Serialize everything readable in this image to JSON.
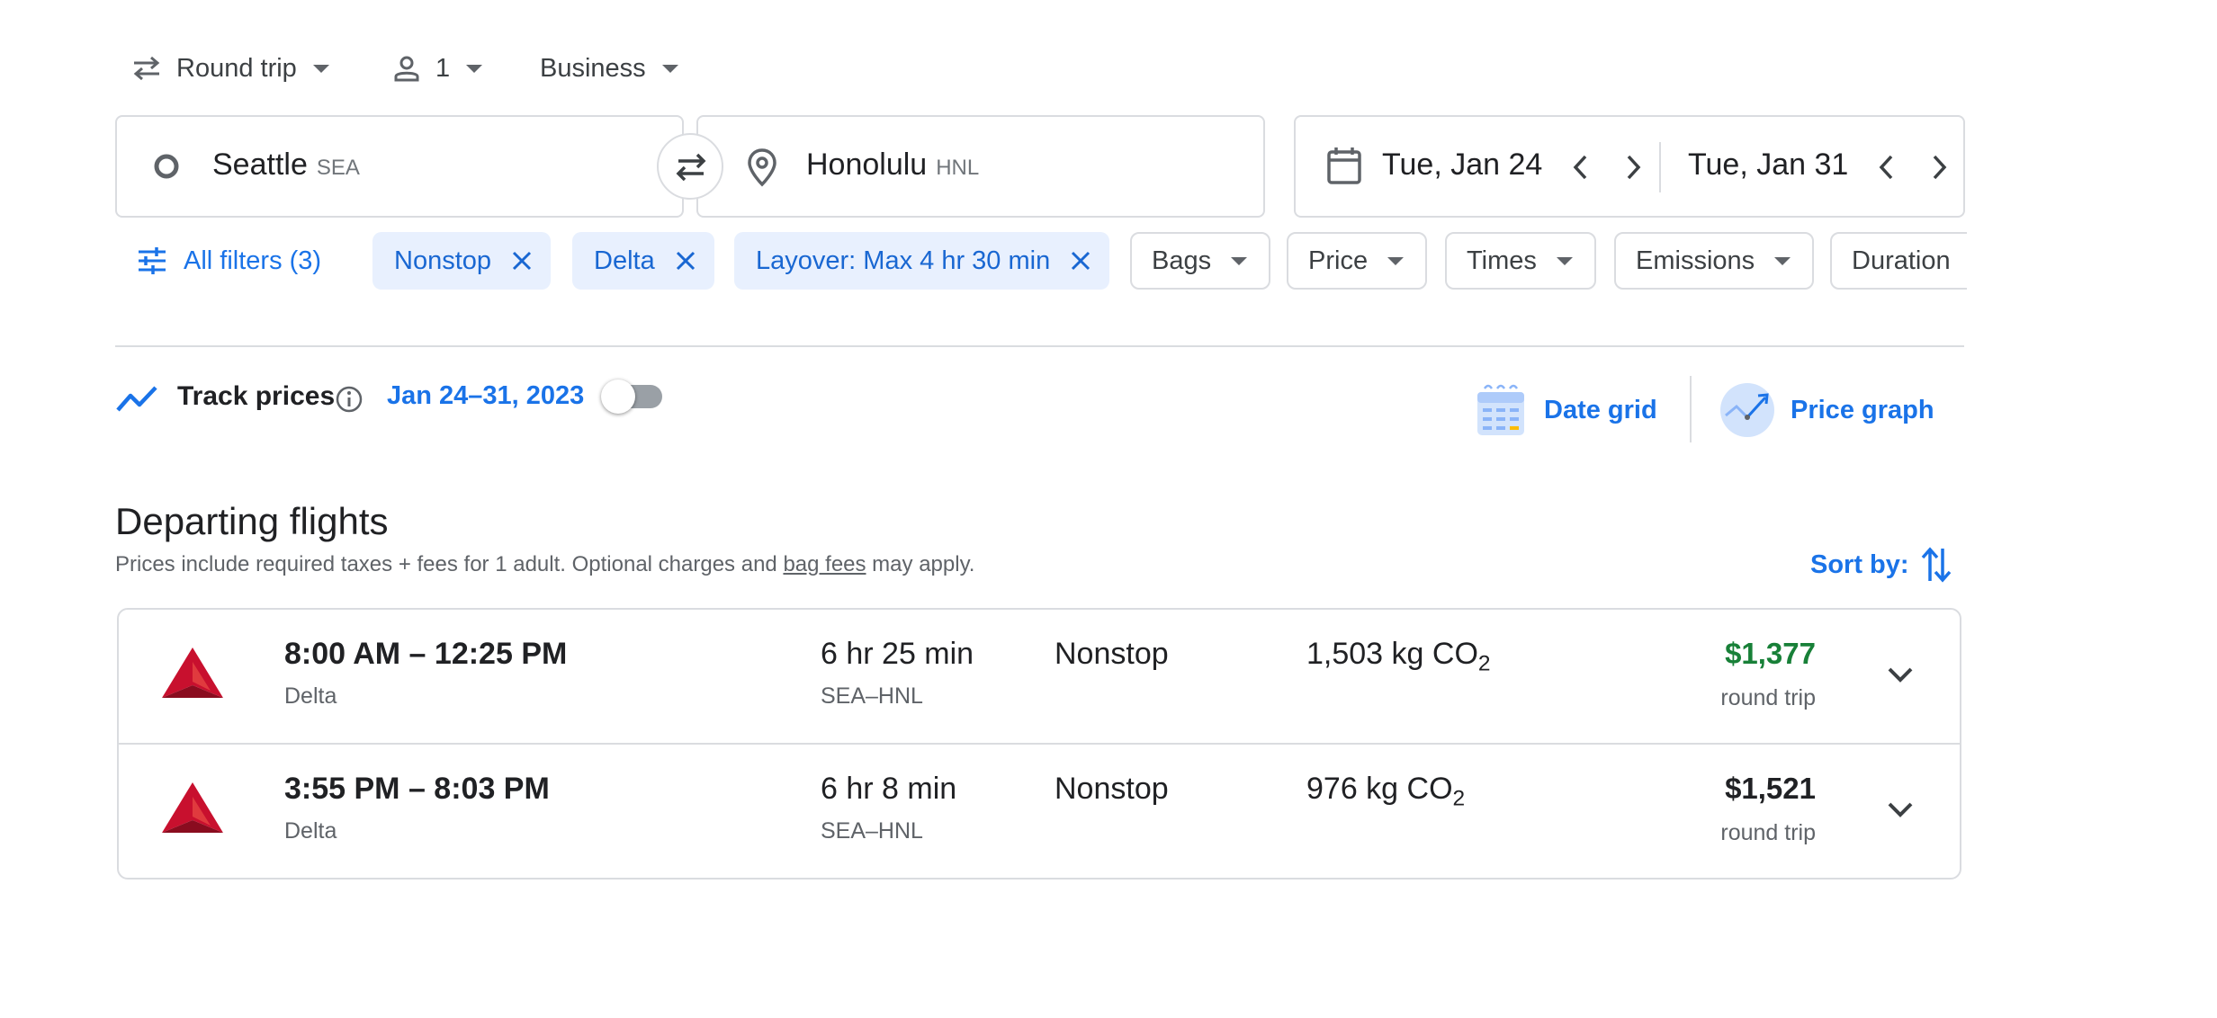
{
  "search": {
    "trip_type": "Round trip",
    "passengers": "1",
    "cabin_class": "Business",
    "origin": {
      "city": "Seattle",
      "code": "SEA"
    },
    "destination": {
      "city": "Honolulu",
      "code": "HNL"
    },
    "depart_date": "Tue, Jan 24",
    "return_date": "Tue, Jan 31"
  },
  "filters": {
    "all_filters_label": "All filters (3)",
    "active": [
      {
        "label": "Nonstop"
      },
      {
        "label": "Delta"
      },
      {
        "label": "Layover: Max 4 hr 30 min"
      }
    ],
    "dropdowns": [
      {
        "label": "Bags"
      },
      {
        "label": "Price"
      },
      {
        "label": "Times"
      },
      {
        "label": "Emissions"
      },
      {
        "label": "Duration"
      }
    ]
  },
  "track_prices": {
    "label": "Track prices",
    "dates": "Jan 24–31, 2023",
    "enabled": false
  },
  "views": {
    "date_grid": "Date grid",
    "price_graph": "Price graph"
  },
  "departing": {
    "title": "Departing flights",
    "note_prefix": "Prices include required taxes + fees for 1 adult. Optional charges and ",
    "note_link": "bag fees",
    "note_suffix": " may apply.",
    "sort_label": "Sort by:"
  },
  "flights": [
    {
      "times": "8:00 AM – 12:25 PM",
      "airline": "Delta",
      "duration": "6 hr 25 min",
      "route": "SEA–HNL",
      "stops": "Nonstop",
      "emissions_value": "1,503 kg CO",
      "emissions_sub": "2",
      "price": "$1,377",
      "price_note": "round trip",
      "price_color": "#188038"
    },
    {
      "times": "3:55 PM – 8:03 PM",
      "airline": "Delta",
      "duration": "6 hr 8 min",
      "route": "SEA–HNL",
      "stops": "Nonstop",
      "emissions_value": "976 kg CO",
      "emissions_sub": "2",
      "price": "$1,521",
      "price_note": "round trip",
      "price_color": "#202124"
    }
  ],
  "colors": {
    "accent_blue": "#1a73e8",
    "chip_blue_bg": "#e8f0fe",
    "delta_red": "#c8102e",
    "border": "#dadce0"
  }
}
